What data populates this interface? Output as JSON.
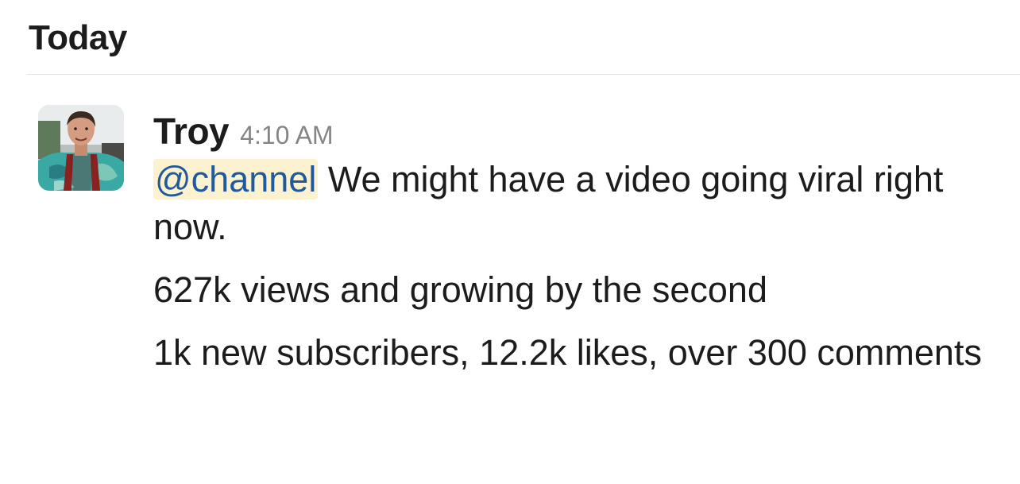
{
  "day_divider": {
    "label": "Today"
  },
  "message": {
    "avatar": {
      "icon": "user-avatar-photo"
    },
    "sender": "Troy",
    "timestamp": "4:10 AM",
    "mention": "@channel",
    "paragraphs": [
      " We might have a video going viral right now.",
      "627k views and growing by the second",
      "1k new subscribers, 12.2k likes, over 300 comments"
    ],
    "colors": {
      "mention_text": "#1d5a9e",
      "mention_background": "#fdf2d0",
      "timestamp": "#858585"
    }
  }
}
